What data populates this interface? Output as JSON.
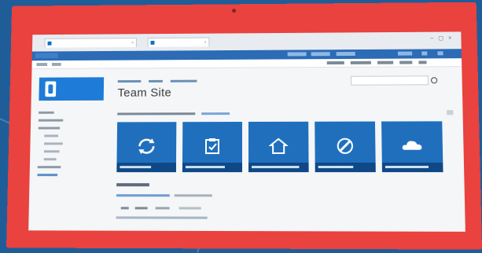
{
  "page": {
    "title": "Team Site"
  },
  "colors": {
    "tablet_frame": "#e9423f",
    "backdrop": "#1f5d99",
    "suite_bar": "#2c6bb5",
    "tile_blue": "#1f6fbd",
    "logo_blue": "#1e7bd7"
  },
  "tiles": [
    {
      "icon": "sync-icon"
    },
    {
      "icon": "checklist-icon"
    },
    {
      "icon": "home-icon"
    },
    {
      "icon": "edit-icon"
    },
    {
      "icon": "cloud-icon"
    }
  ]
}
